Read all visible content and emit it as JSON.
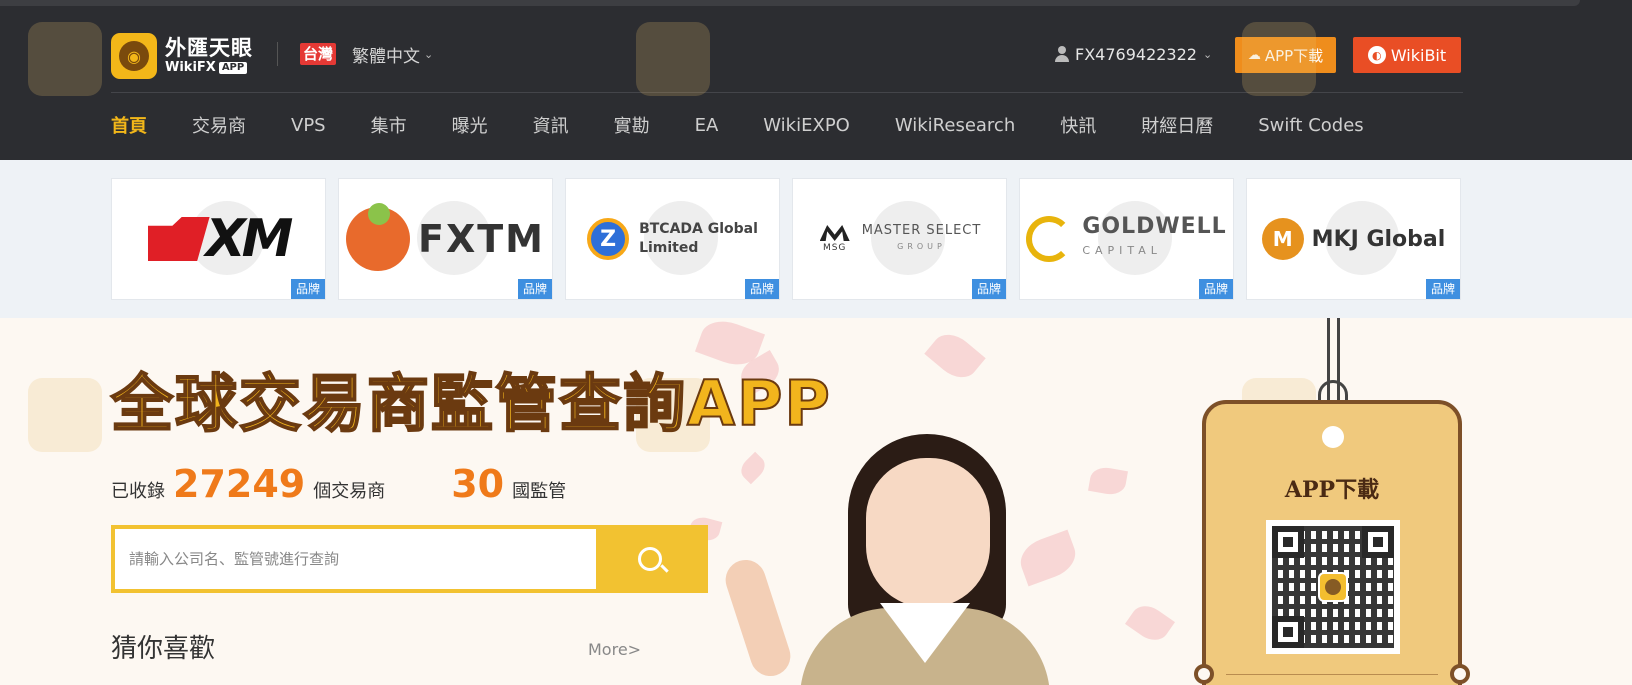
{
  "header": {
    "logo": {
      "cn": "外匯天眼",
      "en": "WikiFX",
      "app_tag": "APP"
    },
    "region": {
      "flag": "台灣",
      "language": "繁體中文"
    },
    "user": {
      "account": "FX4769422322"
    },
    "buttons": {
      "app_download": "APP下載",
      "wikibit": "WikiBit"
    },
    "nav": [
      {
        "label": "首頁",
        "active": true
      },
      {
        "label": "交易商"
      },
      {
        "label": "VPS"
      },
      {
        "label": "集市"
      },
      {
        "label": "曝光"
      },
      {
        "label": "資訊"
      },
      {
        "label": "實勘"
      },
      {
        "label": "EA"
      },
      {
        "label": "WikiEXPO"
      },
      {
        "label": "WikiResearch"
      },
      {
        "label": "快訊"
      },
      {
        "label": "財經日曆"
      },
      {
        "label": "Swift Codes"
      }
    ]
  },
  "brands": {
    "tag": "品牌",
    "items": [
      {
        "name": "XM",
        "text": "XM"
      },
      {
        "name": "FXTM",
        "text": "FXTM"
      },
      {
        "name": "BTCADA Global Limited",
        "line1": "BTCADA Global",
        "line2": "Limited",
        "mark": "Z"
      },
      {
        "name": "MASTER SELECT GROUP",
        "mark_sub": "MSG",
        "line1": "MASTER SELECT",
        "line2": "GROUP"
      },
      {
        "name": "GOLDWELL CAPITAL",
        "line1": "GOLDWELL",
        "line2": "CAPITAL"
      },
      {
        "name": "MKJ Global",
        "text": "MKJ Global",
        "mark": "M"
      }
    ]
  },
  "hero": {
    "title": "全球交易商監管查詢APP",
    "stats": {
      "prefix": "已收錄",
      "brokers": "27249",
      "brokers_label": "個交易商",
      "regulators": "30",
      "regulators_label": "國監管"
    },
    "search": {
      "placeholder": "請輸入公司名、監管號進行查詢",
      "value": ""
    },
    "guess": {
      "title": "猜你喜歡",
      "more": "More>"
    }
  },
  "app_card": {
    "title": "APP下載"
  },
  "colors": {
    "header_bg": "#2c2d31",
    "accent_gold": "#f3b719",
    "app_button": "#ef8d1c",
    "wikibit_button": "#e94e25",
    "brand_tag": "#3e8fe0",
    "number_orange": "#ef7a1a"
  }
}
